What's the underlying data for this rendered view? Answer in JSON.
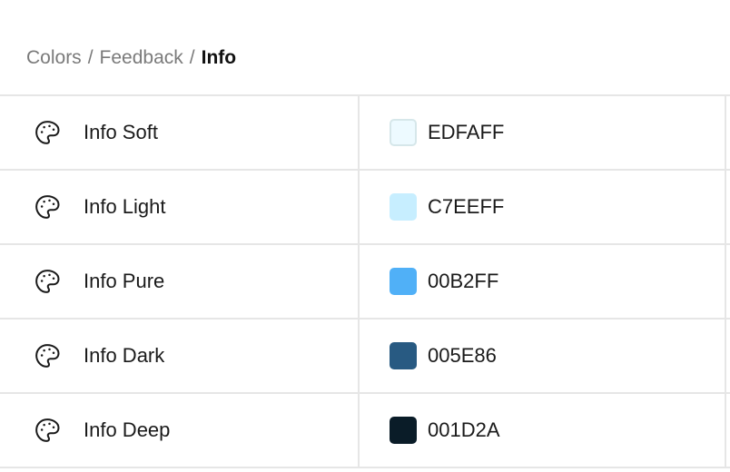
{
  "breadcrumb": {
    "level1": "Colors",
    "level2": "Feedback",
    "current": "Info",
    "separator": "/"
  },
  "colors": [
    {
      "name": "Info Soft",
      "hex": "EDFAFF",
      "swatch": "#EDFAFF",
      "icon": "palette-icon"
    },
    {
      "name": "Info Light",
      "hex": "C7EEFF",
      "swatch": "#C7EEFF",
      "icon": "palette-icon"
    },
    {
      "name": "Info Pure",
      "hex": "00B2FF",
      "swatch": "#50B0F7",
      "icon": "palette-icon"
    },
    {
      "name": "Info Dark",
      "hex": "005E86",
      "swatch": "#285A82",
      "icon": "palette-icon"
    },
    {
      "name": "Info Deep",
      "hex": "001D2A",
      "swatch": "#0A1C28",
      "icon": "palette-icon"
    }
  ]
}
